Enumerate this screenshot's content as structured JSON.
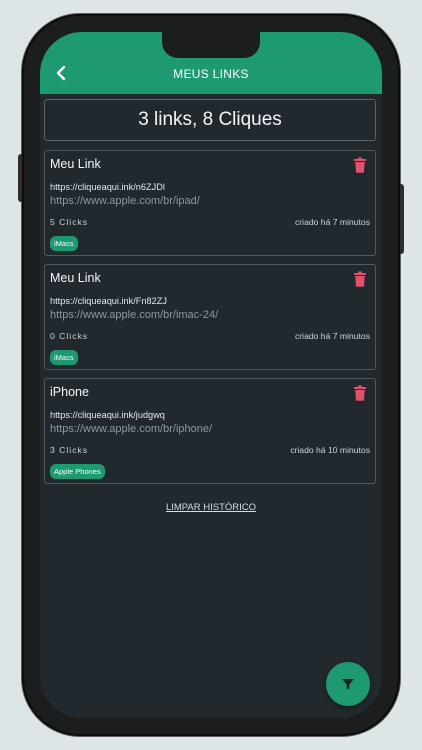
{
  "header": {
    "title": "MEUS LINKS"
  },
  "summary": {
    "text": "3 links, 8 Cliques"
  },
  "links": [
    {
      "name": "Meu Link",
      "short_url": "https://cliqueaqui.ink/n6ZJDl",
      "long_url": "https://www.apple.com/br/ipad/",
      "clicks": "5 Clicks",
      "created": "criado há 7 minutos",
      "tag": "iMacs"
    },
    {
      "name": "Meu Link",
      "short_url": "https://cliqueaqui.ink/Fn82ZJ",
      "long_url": "https://www.apple.com/br/imac-24/",
      "clicks": "0 Clicks",
      "created": "criado há 7 minutos",
      "tag": "iMacs"
    },
    {
      "name": "iPhone",
      "short_url": "https://cliqueaqui.ink/judgwq",
      "long_url": "https://www.apple.com/br/iphone/",
      "clicks": "3 Clicks",
      "created": "criado há 10 minutos",
      "tag": "Apple Phones"
    }
  ],
  "footer": {
    "clear_label": "LIMPAR HISTÓRICO"
  },
  "icons": {
    "back": "chevron-left-icon",
    "delete": "trash-icon",
    "filter": "filter-icon"
  },
  "colors": {
    "accent": "#1d9a72",
    "danger": "#e0526b",
    "background": "#21292f"
  }
}
